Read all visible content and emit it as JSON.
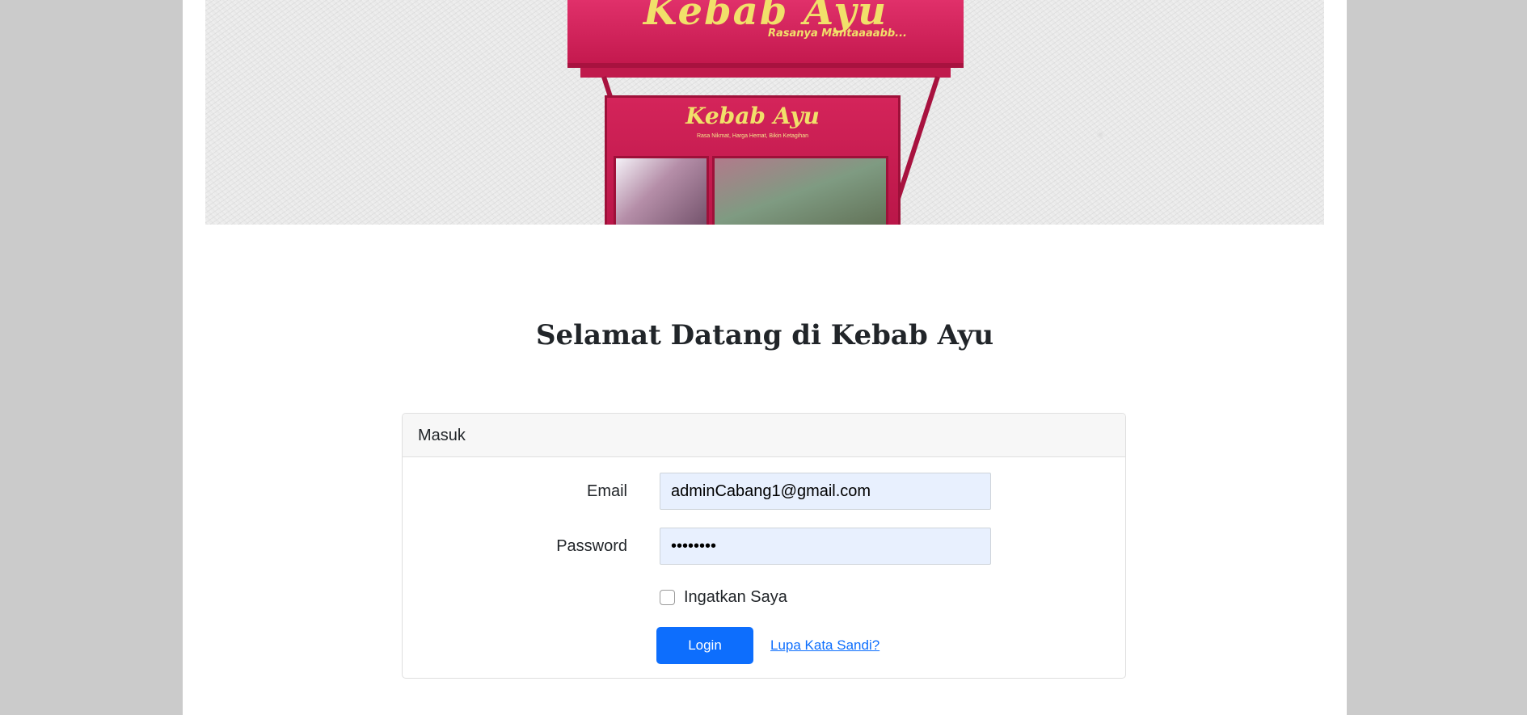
{
  "banner": {
    "alt": "Kebab Ayu cart",
    "cart_title": "Kebab Ayu",
    "cart_tagline": "Rasanya Mantaaaabb...",
    "cart_body_title": "Kebab Ayu",
    "cart_body_sub": "Rasa Nikmat, Harga Hemat, Bikin Ketagihan"
  },
  "page": {
    "title": "Selamat Datang di Kebab Ayu"
  },
  "login_card": {
    "header": "Masuk",
    "email_label": "Email",
    "email_value": "adminCabang1@gmail.com",
    "password_label": "Password",
    "password_value": "••••••••",
    "remember_label": "Ingatkan Saya",
    "remember_checked": false,
    "login_button": "Login",
    "forgot_link": "Lupa Kata Sandi?"
  },
  "colors": {
    "primary": "#0d6efd",
    "background": "#cbcbcb",
    "autofill": "#e8f0fe",
    "cart_red": "#c4194e",
    "cart_yellow": "#f1e06a"
  }
}
